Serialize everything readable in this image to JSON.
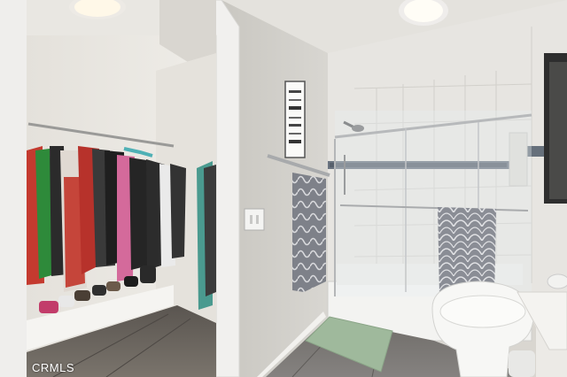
{
  "photo": {
    "watermark": "CRMLS",
    "scene": "bathroom-with-walk-in-closet",
    "colors": {
      "wall": "#cfcdc7",
      "ceiling": "#e6e4df",
      "tile": "#e9e7e3",
      "floor": "#6f6b66",
      "towel": "#8f9299",
      "rug": "#9bb59a",
      "accent_tile": "#5d6670"
    }
  }
}
